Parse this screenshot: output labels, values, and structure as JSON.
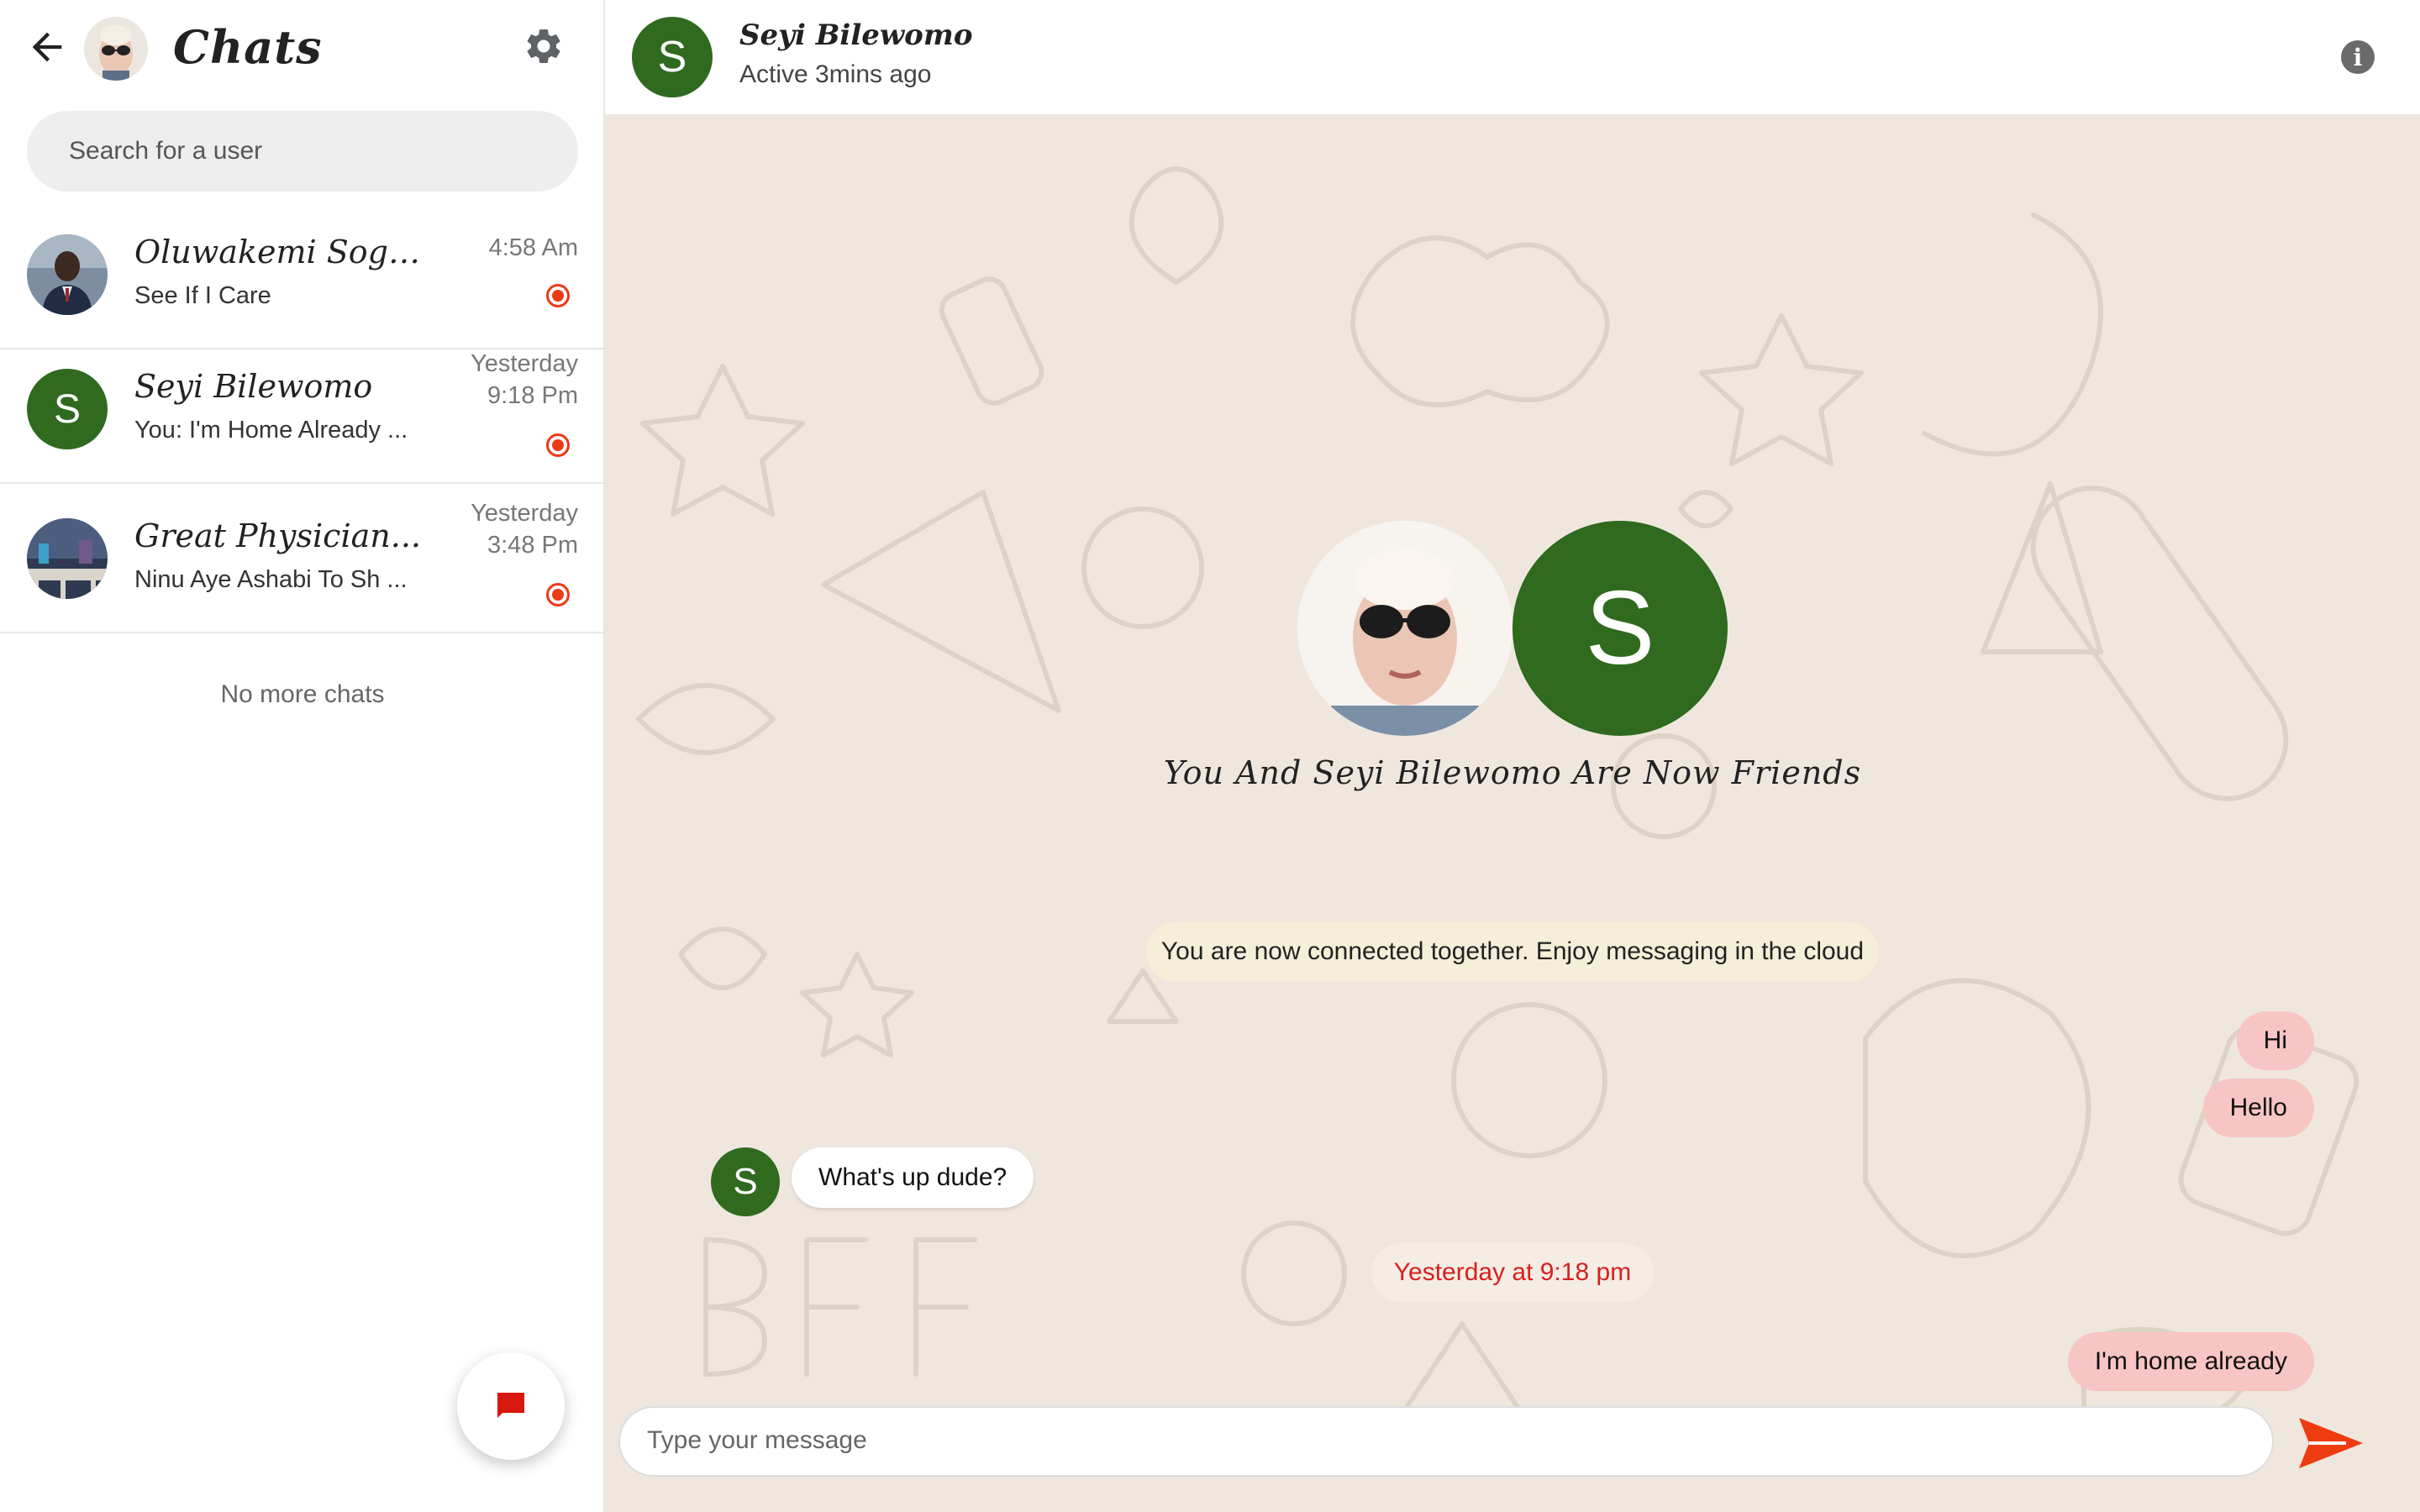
{
  "colors": {
    "accent": "#ea3a16",
    "avatar_green": "#2f6a1f",
    "outgoing_bubble": "#f7c5c3",
    "chat_background": "#efe7de",
    "date_text": "#d81f1f"
  },
  "sidebar": {
    "title": "Chats",
    "search_placeholder": "Search for a user",
    "chats": [
      {
        "name": "Oluwakemi Sogbu...",
        "preview": "See If I Care",
        "time_line1": "4:58 Am",
        "time_line2": "",
        "avatar_letter": ""
      },
      {
        "name": "Seyi Bilewomo",
        "preview": "You: I'm Home Already ...",
        "time_line1": "Yesterday",
        "time_line2": "9:18 Pm",
        "avatar_letter": "S"
      },
      {
        "name": "Great Physician...",
        "preview": "Ninu Aye Ashabi To Sh ...",
        "time_line1": "Yesterday",
        "time_line2": "3:48 Pm",
        "avatar_letter": ""
      }
    ],
    "no_more_label": "No more chats"
  },
  "chat": {
    "contact_name": "Seyi Bilewomo",
    "contact_status": "Active 3mins ago",
    "contact_letter": "S",
    "friends_text": "You And Seyi Bilewomo Are Now Friends",
    "system_note": "You are now connected together. Enjoy messaging in the cloud",
    "messages": [
      {
        "direction": "out",
        "text": "Hi"
      },
      {
        "direction": "out",
        "text": "Hello"
      },
      {
        "direction": "in",
        "text": "What's up dude?"
      },
      {
        "direction": "out",
        "text": "I'm home already"
      }
    ],
    "date_separator": "Yesterday at 9:18 pm",
    "composer_placeholder": "Type your message",
    "info_symbol": "i"
  },
  "icons": [
    "back-arrow-icon",
    "gear-icon",
    "info-icon",
    "chat-bubble-icon",
    "send-icon",
    "unread-dot-icon"
  ]
}
